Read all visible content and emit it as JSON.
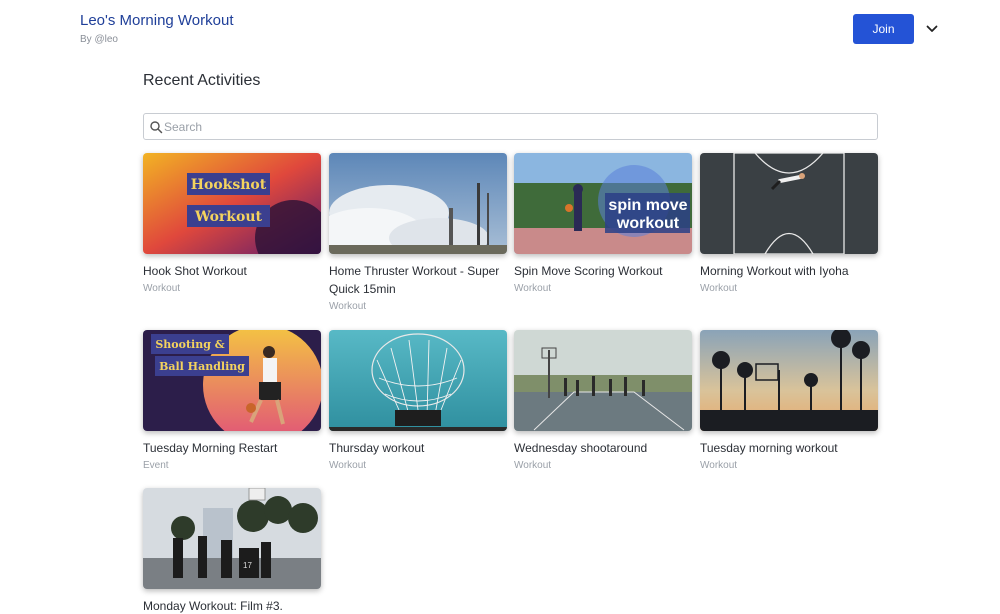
{
  "header": {
    "title": "Leo's Morning Workout",
    "byline": "By @leo",
    "join_label": "Join"
  },
  "section": {
    "title": "Recent Activities"
  },
  "search": {
    "placeholder": "Search"
  },
  "activities": [
    {
      "title": "Hook Shot Workout",
      "type": "Workout",
      "thumb_text": [
        "Hookshot",
        "Workout"
      ]
    },
    {
      "title": "Home Thruster Workout - Super Quick 15min",
      "type": "Workout"
    },
    {
      "title": "Spin Move Scoring Workout",
      "type": "Workout",
      "thumb_text": [
        "spin move",
        "workout"
      ]
    },
    {
      "title": "Morning Workout with Iyoha",
      "type": "Workout"
    },
    {
      "title": "Tuesday Morning Restart",
      "type": "Event",
      "thumb_text": [
        "Shooting &",
        "Ball Handling"
      ]
    },
    {
      "title": "Thursday workout",
      "type": "Workout"
    },
    {
      "title": "Wednesday shootaround",
      "type": "Workout"
    },
    {
      "title": "Tuesday morning workout",
      "type": "Workout"
    },
    {
      "title": "Monday Workout: Film #3.",
      "type": ""
    }
  ],
  "colors": {
    "brand_title": "#1f3f99",
    "join_button": "#2453d6",
    "muted_text": "#9aa0a8"
  },
  "icons": {
    "search": "search-icon",
    "menu_toggle": "chevron-down-icon"
  }
}
